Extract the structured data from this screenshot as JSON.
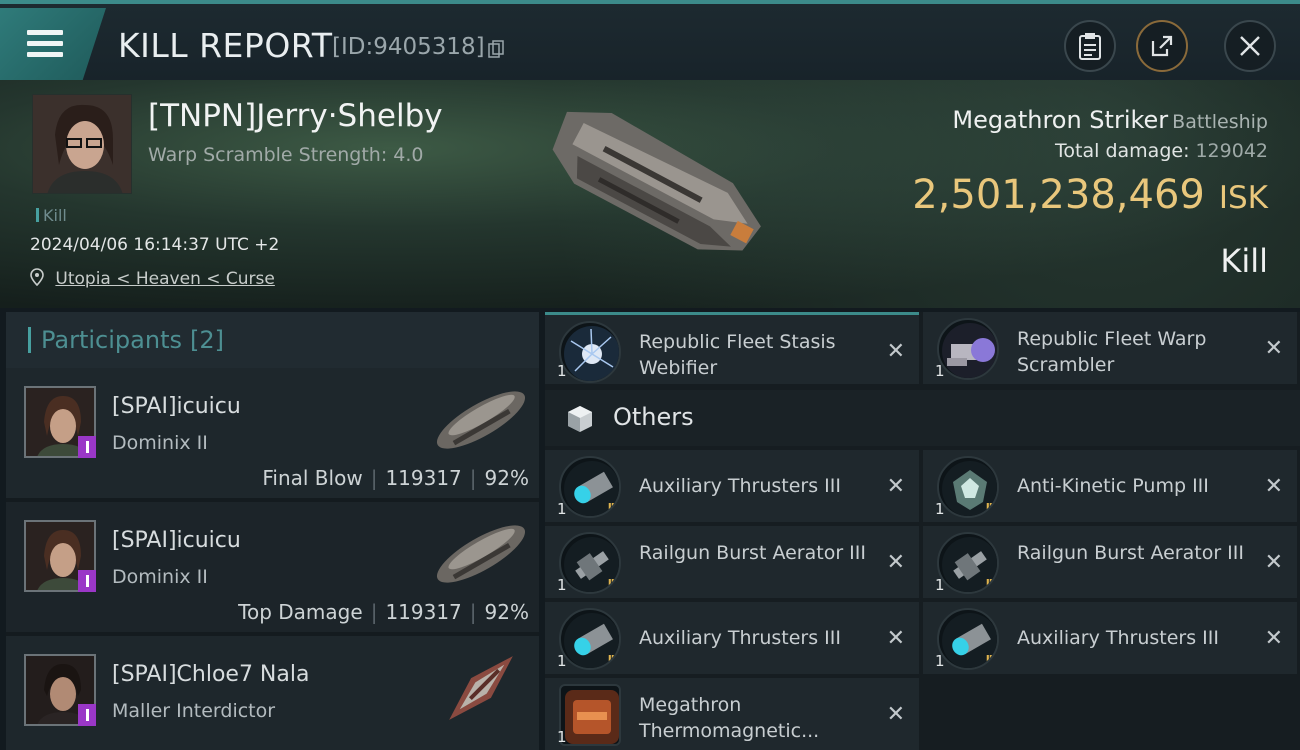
{
  "header": {
    "title": "KILL REPORT",
    "report_id": "[ID:9405318]"
  },
  "victim": {
    "name": "[TNPN]Jerry·Shelby",
    "warp_scramble": "Warp Scramble Strength: 4.0",
    "tag": "Kill",
    "datetime": "2024/04/06 16:14:37 UTC +2",
    "location": "Utopia < Heaven < Curse",
    "ship_name": "Megathron Striker",
    "ship_class": "Battleship",
    "total_damage_label": "Total damage:",
    "total_damage": "129042",
    "isk_value": "2,501,238,469",
    "isk_unit": "ISK",
    "result": "Kill"
  },
  "participants": {
    "label": "Participants",
    "count": "[2]",
    "rows": [
      {
        "name": "[SPAI]icuicu",
        "ship": "Dominix II",
        "role": "Final Blow",
        "damage": "119317",
        "percent": "92%"
      },
      {
        "name": "[SPAI]icuicu",
        "ship": "Dominix II",
        "role": "Top Damage",
        "damage": "119317",
        "percent": "92%"
      },
      {
        "name": "[SPAI]Chloe7 Nala",
        "ship": "Maller Interdictor"
      }
    ]
  },
  "modules": {
    "top": [
      {
        "name": "Republic Fleet Stasis Webifier",
        "qty": "1"
      },
      {
        "name": "Republic Fleet Warp Scrambler",
        "qty": "1"
      }
    ],
    "others_label": "Others",
    "others": [
      {
        "name": "Auxiliary Thrusters III",
        "qty": "1"
      },
      {
        "name": "Anti-Kinetic Pump III",
        "qty": "1"
      },
      {
        "name": "Railgun Burst Aerator III",
        "qty": "1"
      },
      {
        "name": "Railgun Burst Aerator III",
        "qty": "1"
      },
      {
        "name": "Auxiliary Thrusters III",
        "qty": "1"
      },
      {
        "name": "Auxiliary Thrusters III",
        "qty": "1"
      },
      {
        "name": "Megathron Thermomagnetic...",
        "qty": "1"
      }
    ],
    "close_glyph": "✕"
  },
  "colors": {
    "accent": "#3c8b8a",
    "isk": "#e9c77c",
    "badge": "#9a37c7"
  }
}
